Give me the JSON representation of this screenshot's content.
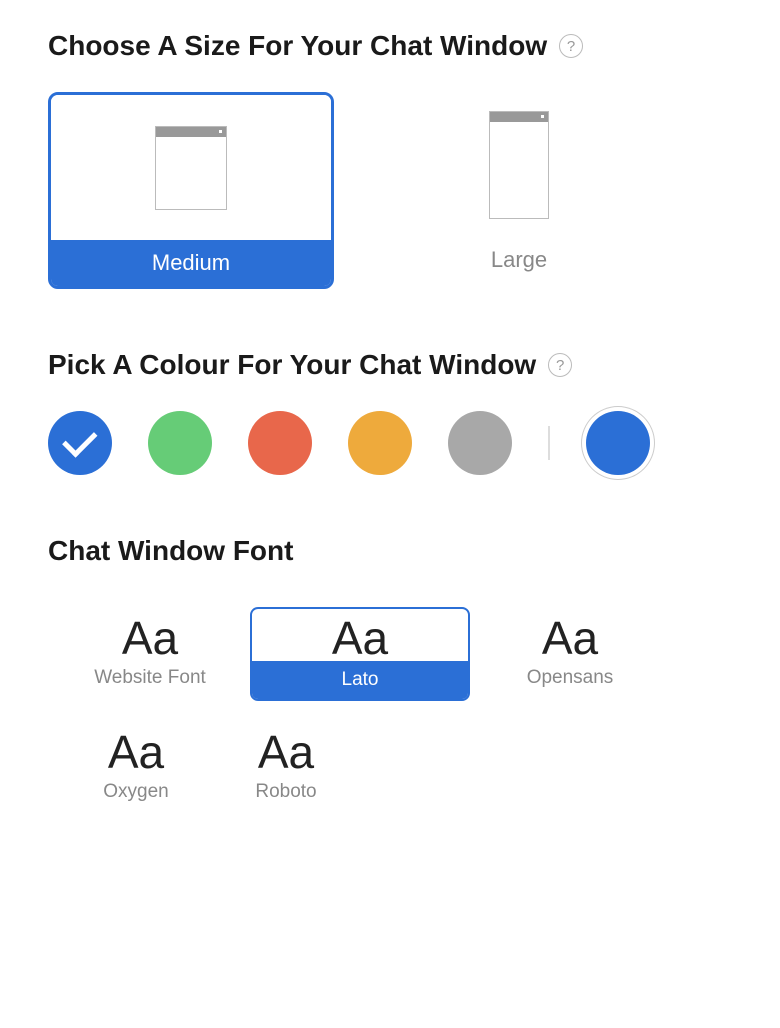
{
  "size_section": {
    "title": "Choose A Size For Your Chat Window",
    "options": [
      {
        "id": "medium",
        "label": "Medium",
        "selected": true
      },
      {
        "id": "large",
        "label": "Large",
        "selected": false
      }
    ]
  },
  "color_section": {
    "title": "Pick A Colour For Your Chat Window",
    "swatches": [
      {
        "id": "blue",
        "hex": "#2b6fd6",
        "selected": true
      },
      {
        "id": "green",
        "hex": "#66cc77",
        "selected": false
      },
      {
        "id": "orange-red",
        "hex": "#e8674b",
        "selected": false
      },
      {
        "id": "yellow-orange",
        "hex": "#eeaa3c",
        "selected": false
      },
      {
        "id": "gray",
        "hex": "#a8a8a8",
        "selected": false
      }
    ],
    "custom_color": "#2b6fd6"
  },
  "font_section": {
    "title": "Chat Window Font",
    "sample_text": "Aa",
    "options": [
      {
        "id": "website-font",
        "label": "Website Font",
        "selected": false
      },
      {
        "id": "lato",
        "label": "Lato",
        "selected": true
      },
      {
        "id": "opensans",
        "label": "Opensans",
        "selected": false
      },
      {
        "id": "oxygen",
        "label": "Oxygen",
        "selected": false
      },
      {
        "id": "roboto",
        "label": "Roboto",
        "selected": false
      }
    ]
  }
}
